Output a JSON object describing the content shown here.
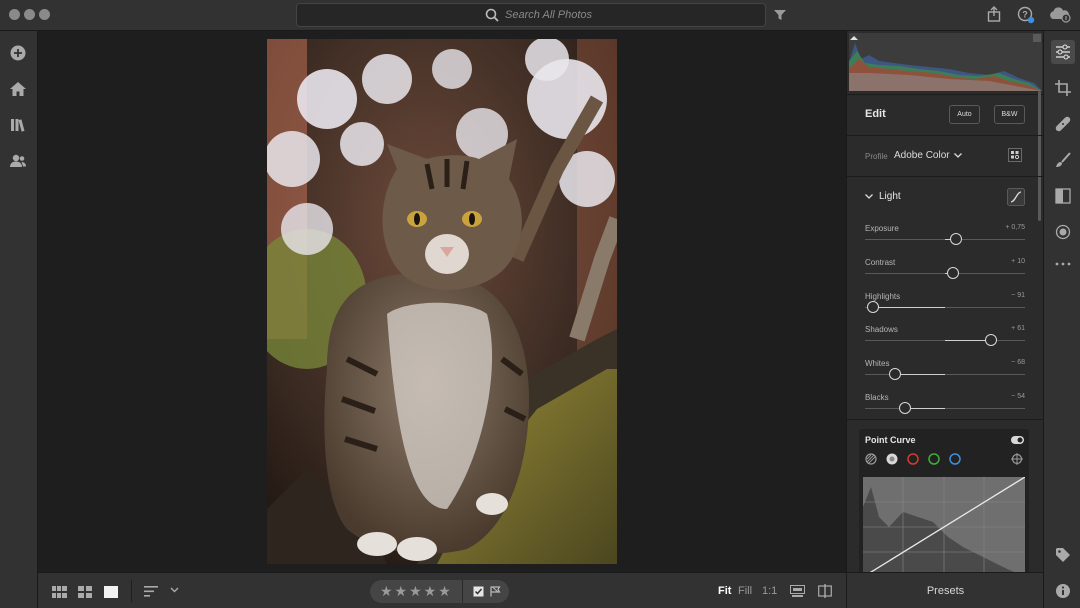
{
  "search": {
    "placeholder": "Search All Photos"
  },
  "edit": {
    "title": "Edit",
    "auto_label": "Auto",
    "bw_label": "B&W",
    "profile_label": "Profile",
    "profile_value": "Adobe Color"
  },
  "light": {
    "title": "Light",
    "sliders": [
      {
        "label": "Exposure",
        "value": "+ 0,75",
        "level": 0.57
      },
      {
        "label": "Contrast",
        "value": "+ 10",
        "level": 0.55
      },
      {
        "label": "Highlights",
        "value": "− 91",
        "level": 0.05
      },
      {
        "label": "Shadows",
        "value": "+ 61",
        "level": 0.79
      },
      {
        "label": "Whites",
        "value": "− 68",
        "level": 0.19
      },
      {
        "label": "Blacks",
        "value": "− 54",
        "level": 0.25
      }
    ]
  },
  "point_curve": {
    "title": "Point Curve"
  },
  "bottom": {
    "fit": "Fit",
    "fill": "Fill",
    "one_to_one": "1:1",
    "stars": "★★★★★"
  },
  "presets": {
    "label": "Presets"
  },
  "colors": {
    "accent_red": "#d23b2f",
    "accent_green": "#3fae3a",
    "accent_blue": "#3d8fe0"
  }
}
